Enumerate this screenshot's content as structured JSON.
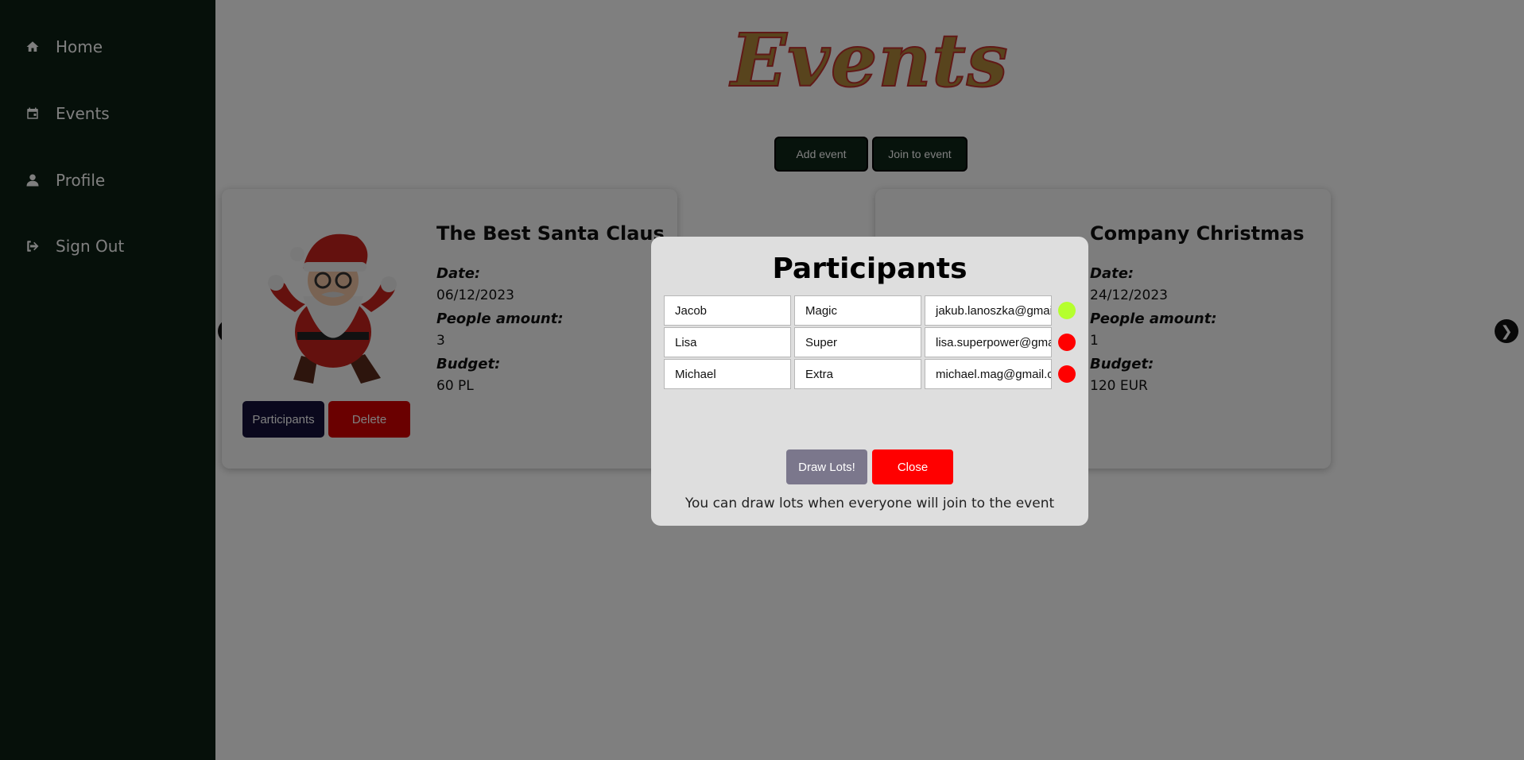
{
  "sidebar": {
    "items": [
      {
        "label": "Home",
        "icon": "home-icon"
      },
      {
        "label": "Events",
        "icon": "calendar-icon"
      },
      {
        "label": "Profile",
        "icon": "user-icon"
      },
      {
        "label": "Sign Out",
        "icon": "sign-out-icon"
      }
    ]
  },
  "page": {
    "title": "Events",
    "add_event_label": "Add event",
    "join_event_label": "Join to event"
  },
  "events": [
    {
      "title": "The Best Santa Claus",
      "date_label": "Date:",
      "date": "06/12/2023",
      "people_label": "People amount:",
      "people": "3",
      "budget_label": "Budget:",
      "budget": "60 PL",
      "participants_label": "Participants",
      "delete_label": "Delete"
    },
    {
      "title": "Company Christmas",
      "date_label": "Date:",
      "date": "24/12/2023",
      "people_label": "People amount:",
      "people": "1",
      "budget_label": "Budget:",
      "budget": "120 EUR"
    }
  ],
  "modal": {
    "title": "Participants",
    "participants": [
      {
        "first": "Jacob",
        "last": "Magic",
        "email": "jakub.lanoszka@gmail.com",
        "joined": true
      },
      {
        "first": "Lisa",
        "last": "Super",
        "email": "lisa.superpower@gmail.com",
        "joined": false
      },
      {
        "first": "Michael",
        "last": "Extra",
        "email": "michael.mag@gmail.com",
        "joined": false
      }
    ],
    "draw_label": "Draw Lots!",
    "close_label": "Close",
    "note": "You can draw lots when everyone will join to the event"
  },
  "colors": {
    "sidebar_bg": "#0c2014",
    "joined": "#b5ff2e",
    "not_joined": "#ff0000",
    "draw_button": "#7b778c",
    "close_button": "#ff0000",
    "participants_button": "#14103a",
    "delete_button": "#d40000"
  }
}
